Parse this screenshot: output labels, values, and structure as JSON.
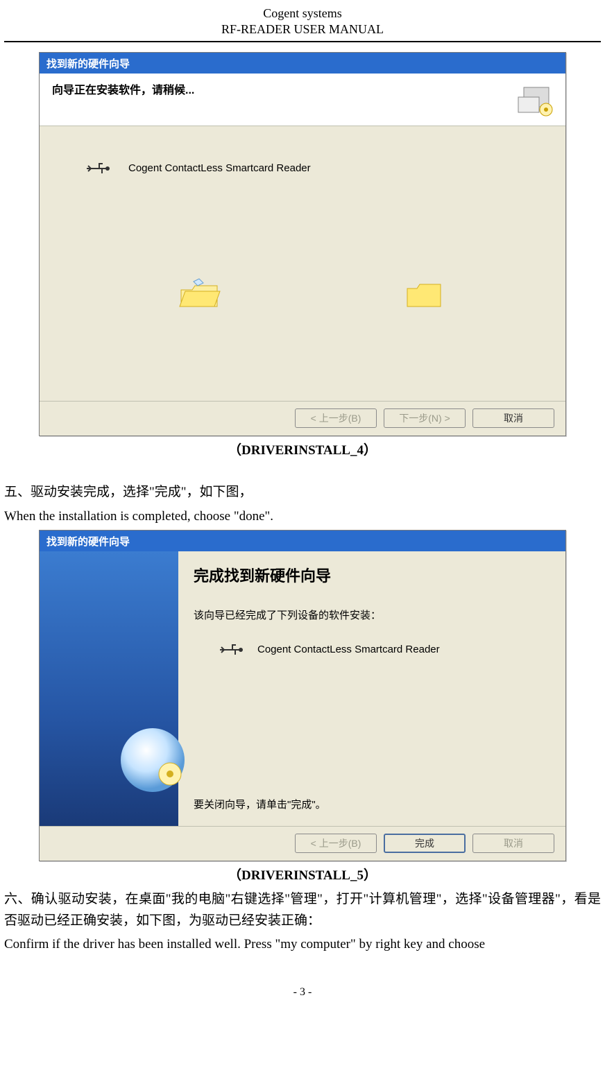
{
  "header": {
    "line1": "Cogent systems",
    "line2": "RF-READER USER MANUAL"
  },
  "dialog1": {
    "titlebar": "找到新的硬件向导",
    "strip_title": "向导正在安装软件，请稍候...",
    "usb_label": "Cogent ContactLess Smartcard Reader",
    "btn_back": "< 上一步(B)",
    "btn_next": "下一步(N) >",
    "btn_cancel": "取消"
  },
  "caption1": "（DRIVERINSTALL_4）",
  "step5_cn": "五、驱动安装完成，选择\"完成\"，如下图，",
  "step5_en": "When the installation is completed, choose \"done\".",
  "dialog2": {
    "titlebar": "找到新的硬件向导",
    "rp_title": "完成找到新硬件向导",
    "rp_sub": "该向导已经完成了下列设备的软件安装：",
    "rp_device": "Cogent ContactLess Smartcard Reader",
    "rp_close": "要关闭向导，请单击\"完成\"。",
    "btn_back": "< 上一步(B)",
    "btn_finish": "完成",
    "btn_cancel": "取消"
  },
  "caption2": "（DRIVERINSTALL_5）",
  "step6_cn": "六、确认驱动安装，在桌面\"我的电脑\"右键选择\"管理\"，打开\"计算机管理\"，选择\"设备管理器\"，看是否驱动已经正确安装，如下图，为驱动已经安装正确：",
  "step6_en": "Confirm if the driver has been installed well.  Press \"my computer\" by right key and choose",
  "page_number": "- 3 -"
}
